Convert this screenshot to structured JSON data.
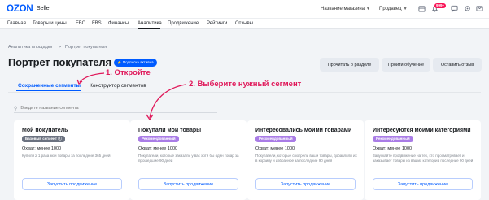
{
  "header": {
    "brand": "OZON",
    "brand_sub": "Seller",
    "store_selector": "Название магазина",
    "seller_selector": "Продавец",
    "notifications_badge": "999+"
  },
  "nav": {
    "items": [
      "Главная",
      "Товары и цены",
      "FBO",
      "FBS",
      "Финансы",
      "Аналитика",
      "Продвижение",
      "Рейтинги",
      "Отзывы"
    ],
    "active": "Аналитика"
  },
  "breadcrumb": {
    "items": [
      "Аналитика площадки",
      ">",
      "Портрет покупателя"
    ]
  },
  "page": {
    "title": "Портрет покупателя",
    "subscription_badge": "Подписка активна",
    "buttons": [
      "Прочитать о разделе",
      "Пройти обучение",
      "Оставить отзыв"
    ]
  },
  "tabs": {
    "items": [
      "Сохраненные сегменты",
      "Конструктор сегментов"
    ],
    "active": "Сохраненные сегменты"
  },
  "search": {
    "placeholder": "Введите название сегмента"
  },
  "annotations": {
    "step1": "1. Откройте",
    "step2": "2. Выберите нужный сегмент",
    "color": "#e0185a"
  },
  "cards": [
    {
      "title": "Мой покупатель",
      "badge": "Базовый сегмент",
      "badge_style": "gray",
      "reach": "Охват: менее 1000",
      "desc": "Купили ≥ 1 раза мои товары за последние 365 дней",
      "button": "Запустить продвижение"
    },
    {
      "title": "Покупали мои товары",
      "badge": "Рекомендованный",
      "badge_style": "purple",
      "reach": "Охват: менее 1000",
      "desc": "Покупатели, которые заказали у вас хотя бы один товар за прошедшие 90 дней",
      "button": "Запустить продвижение"
    },
    {
      "title": "Интересовались моими товарами",
      "badge": "Рекомендованный",
      "badge_style": "purple",
      "reach": "Охват: менее 1000",
      "desc": "Покупатели, которые смотрели ваши товары, добавляли их в корзину и избранное за последние 90 дней",
      "button": "Запустить продвижение"
    },
    {
      "title": "Интересуются моими категориями",
      "badge": "Рекомендованный",
      "badge_style": "purple",
      "reach": "Охват: менее 1000",
      "desc": "Запускайте продвижение на тех, кто просматривает и заказывает товары из ваших категорий последние 90 дней",
      "button": "Запустить продвижение"
    }
  ],
  "colors": {
    "accent": "#005bff",
    "annotation": "#e0185a",
    "badge_gray": "#6b7280",
    "badge_purple": "#a97ce6",
    "background": "#f2f4f7"
  }
}
